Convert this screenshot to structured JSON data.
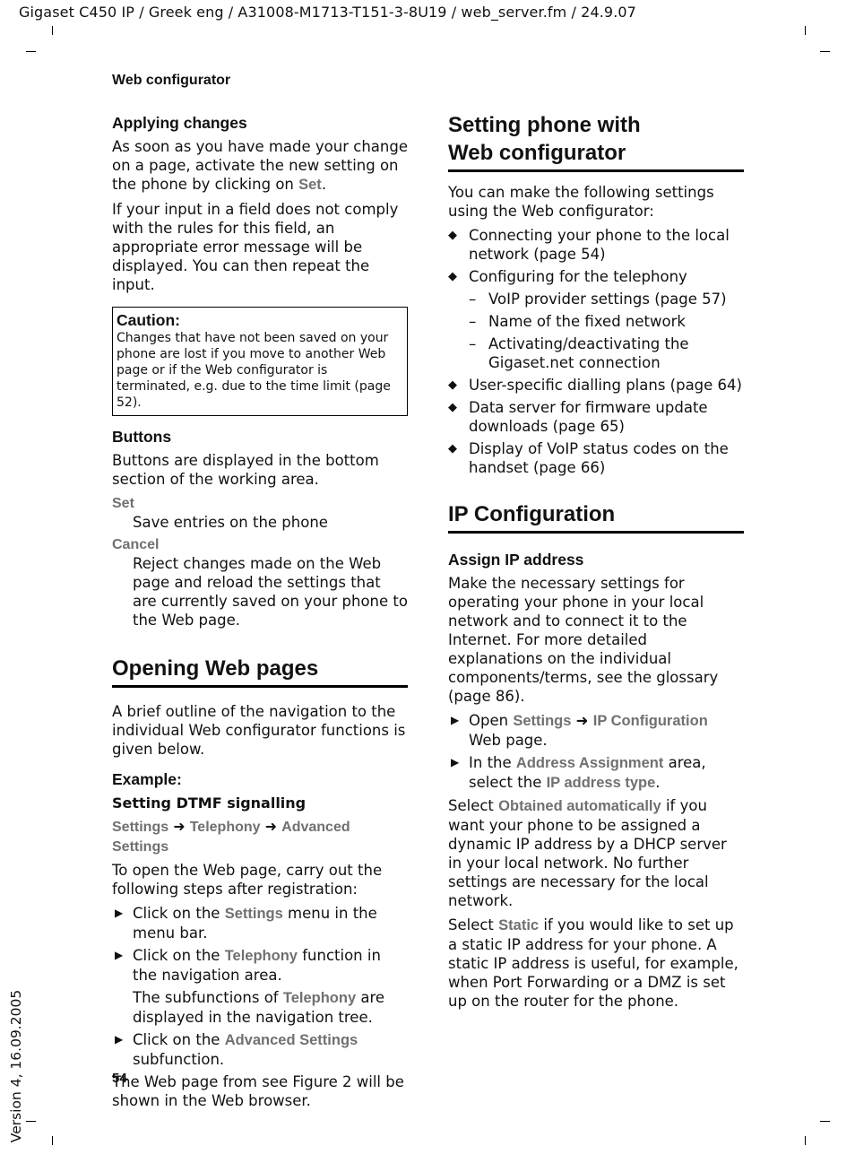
{
  "header": {
    "doc_line": "Gigaset C450 IP / Greek eng / A31008-M1713-T151-3-8U19 / web_server.fm / 24.9.07",
    "running_head": "Web configurator",
    "version": "Version 4, 16.09.2005",
    "page_number": "54"
  },
  "left": {
    "applying": {
      "heading": "Applying changes",
      "p1_pre": "As soon as you have made your change on a page, activate the new setting on the phone by clicking on ",
      "p1_ui": "Set",
      "p1_post": ".",
      "p2": "If your input in a field does not comply with the rules for this field, an appropriate error message will be displayed. You can then repeat the input."
    },
    "caution": {
      "title": "Caution:",
      "text": "Changes that have not been saved on your phone are lost if you move to another Web page or if the Web configurator is terminated, e.g. due to the time limit (page 52)."
    },
    "buttons": {
      "heading": "Buttons",
      "intro": "Buttons are displayed in the bottom section of the working area.",
      "items": [
        {
          "term": "Set",
          "desc": "Save entries on the phone"
        },
        {
          "term": "Cancel",
          "desc": "Reject changes made on the Web page and reload the settings that are currently saved on your phone to the Web page."
        }
      ]
    },
    "opening": {
      "heading": "Opening Web pages",
      "intro": "A brief outline of the navigation to the individual Web configurator functions is given below.",
      "example_label": "Example:",
      "example_title": "Setting DTMF signalling",
      "path": [
        "Settings",
        "Telephony",
        "Advanced Settings"
      ],
      "arrow": "➜",
      "steps_intro": "To open the Web page, carry out the following steps after registration:",
      "step1_pre": "Click on the ",
      "step1_ui": "Settings",
      "step1_post": " menu in the menu bar.",
      "step2_pre": "Click on the ",
      "step2_ui": "Telephony",
      "step2_post": " function in the navigation area.",
      "step2_note_pre": "The subfunctions of ",
      "step2_note_ui": "Telephony",
      "step2_note_post": " are displayed in the navigation tree.",
      "step3_pre": "Click on the ",
      "step3_ui": "Advanced Settings",
      "step3_post": " subfunction.",
      "outro": "The Web page from see Figure 2 will be shown in the Web browser."
    }
  },
  "right": {
    "setting": {
      "heading_line1": "Setting phone with",
      "heading_line2": "Web configurator",
      "intro": "You can make the following settings using the Web configurator:",
      "bullets": [
        "Connecting your phone to the local network (page 54)",
        "Configuring for the telephony",
        "User-specific dialling plans (page 64)",
        "Data server for firmware update downloads (page 65)",
        "Display of VoIP status codes on the handset (page 66)"
      ],
      "sub_bullets": [
        "VoIP provider settings (page 57)",
        "Name of the fixed network",
        "Activating/deactivating the Gigaset.net connection"
      ]
    },
    "ip": {
      "heading": "IP Configuration",
      "subheading": "Assign IP address",
      "intro": "Make the necessary settings for operating your phone in your local network and to connect it to the Internet. For more detailed explanations on the individual components/terms, see the glossary (page 86).",
      "step1_pre": "Open ",
      "step1_ui1": "Settings",
      "step1_ui2": "IP Configuration",
      "step1_post": " Web page.",
      "step2_pre": "In the ",
      "step2_ui1": "Address Assignment",
      "step2_mid": " area, select the ",
      "step2_ui2": "IP address type",
      "step2_post": ".",
      "p_auto_pre": "Select ",
      "p_auto_ui": "Obtained automatically",
      "p_auto_post": " if you want your phone to be assigned a dynamic IP address by a DHCP server in your local network. No further settings are necessary for the local network.",
      "p_static_pre": "Select ",
      "p_static_ui": "Static",
      "p_static_post": " if you would like to set up a static IP address for your phone. A static IP address is useful, for example, when Port Forwarding or a DMZ is set up on the router for the phone."
    }
  },
  "icons": {
    "step": "▶",
    "bullet": "◆",
    "dash": "–"
  }
}
